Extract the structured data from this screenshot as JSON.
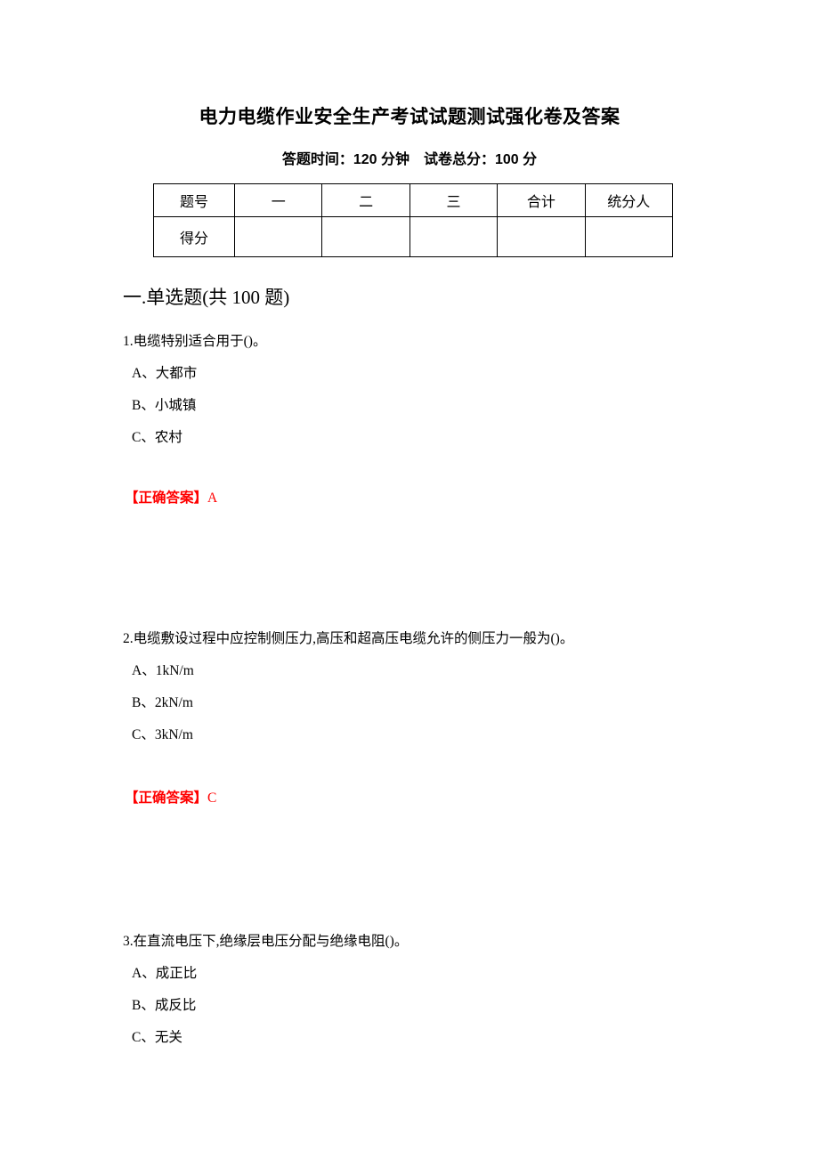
{
  "document": {
    "title": "电力电缆作业安全生产考试试题测试强化卷及答案",
    "subtitle": "答题时间：120 分钟　试卷总分：100 分"
  },
  "score_table": {
    "headers": [
      "题号",
      "一",
      "二",
      "三",
      "合计",
      "统分人"
    ],
    "rows": [
      {
        "label": "得分",
        "cells": [
          "",
          "",
          "",
          "",
          ""
        ]
      }
    ]
  },
  "section": {
    "heading": "一.单选题(共 100 题)"
  },
  "answer_label": "【正确答案】",
  "questions": [
    {
      "stem": "1.电缆特别适合用于()。",
      "options": [
        "A、大都市",
        "B、小城镇",
        "C、农村"
      ],
      "answer": "A"
    },
    {
      "stem": "2.电缆敷设过程中应控制侧压力,高压和超高压电缆允许的侧压力一般为()。",
      "options": [
        "A、1kN/m",
        "B、2kN/m",
        "C、3kN/m"
      ],
      "answer": "C"
    },
    {
      "stem": "3.在直流电压下,绝缘层电压分配与绝缘电阻()。",
      "options": [
        "A、成正比",
        "B、成反比",
        "C、无关"
      ],
      "answer": ""
    }
  ],
  "colors": {
    "answer_red": "#ff0000",
    "text_black": "#000000",
    "table_border": "#000000"
  }
}
